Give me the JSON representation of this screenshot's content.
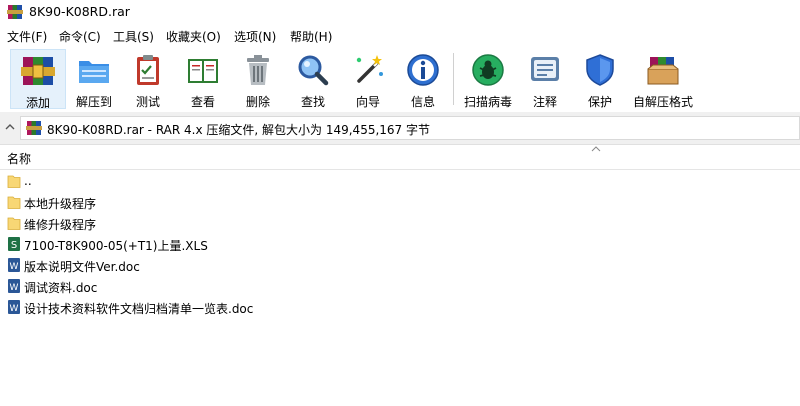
{
  "window": {
    "title": "8K90-K08RD.rar"
  },
  "menu": [
    "文件(F)",
    "命令(C)",
    "工具(S)",
    "收藏夹(O)",
    "选项(N)",
    "帮助(H)"
  ],
  "toolbar": {
    "add": "添加",
    "extract": "解压到",
    "test": "测试",
    "view": "查看",
    "delete": "删除",
    "find": "查找",
    "wizard": "向导",
    "info": "信息",
    "scan": "扫描病毒",
    "comment": "注释",
    "protect": "保护",
    "sfx": "自解压格式"
  },
  "address": {
    "text": "8K90-K08RD.rar - RAR 4.x 压缩文件, 解包大小为 149,455,167 字节"
  },
  "list": {
    "column_name": "名称",
    "rows": [
      {
        "name": "..",
        "icon": "folder-icon"
      },
      {
        "name": "本地升级程序",
        "icon": "folder-icon"
      },
      {
        "name": "维修升级程序",
        "icon": "folder-icon"
      },
      {
        "name": "7100-T8K900-05(+T1)上量.XLS",
        "icon": "excel-file-icon"
      },
      {
        "name": "版本说明文件Ver.doc",
        "icon": "word-file-icon"
      },
      {
        "name": "调试资料.doc",
        "icon": "word-file-icon"
      },
      {
        "name": "设计技术资料软件文档归档清单一览表.doc",
        "icon": "word-file-icon"
      }
    ]
  },
  "colors": {
    "selected_bg": "#e5f1fb",
    "address_bg": "#f0f0f0",
    "folder": "#f8d775",
    "excel": "#1e7145",
    "word": "#2b5797"
  }
}
